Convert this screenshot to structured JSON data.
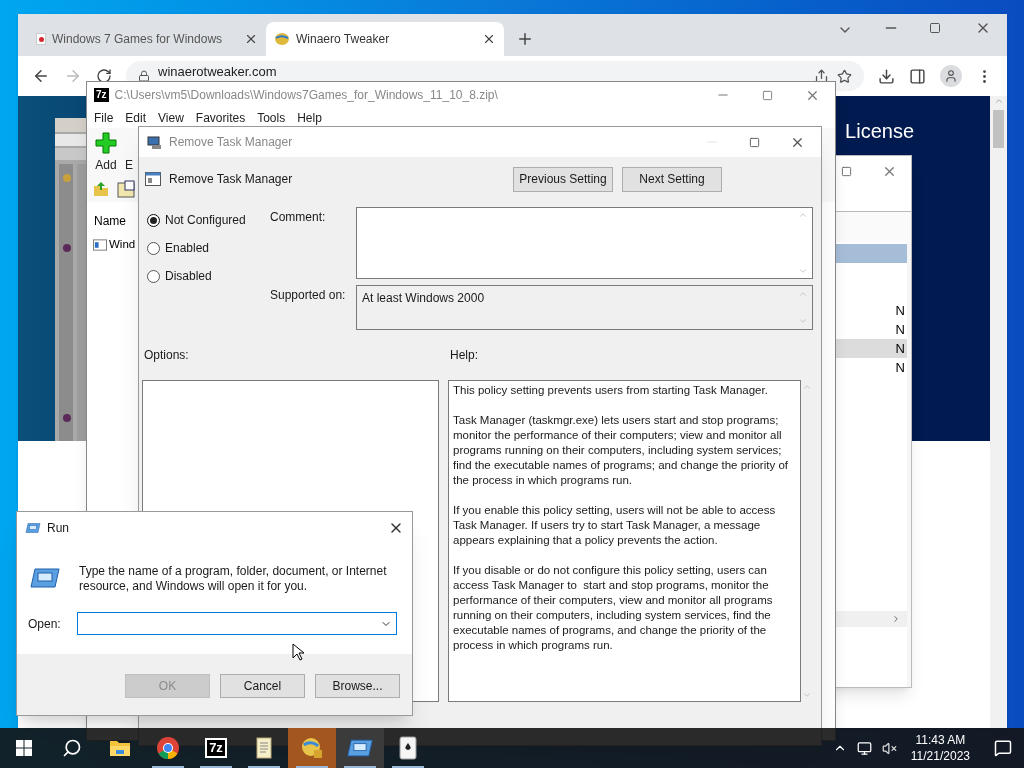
{
  "browser": {
    "tabs": [
      {
        "title": "Windows 7 Games for Windows",
        "selected": false
      },
      {
        "title": "Winaero Tweaker",
        "selected": true
      }
    ],
    "url": "winaerotweaker.com",
    "page_nav": [
      "License"
    ]
  },
  "back_window": {
    "rows": [
      {
        "selected": true,
        "hovered": false
      },
      {
        "cell": "N",
        "selected": false,
        "hovered": false
      },
      {
        "cell": "N",
        "selected": false,
        "hovered": false
      },
      {
        "cell": "N",
        "selected": false,
        "hovered": true
      },
      {
        "cell": "N",
        "selected": false,
        "hovered": false
      }
    ]
  },
  "archiver": {
    "icon_label": "7z",
    "title": "C:\\Users\\vm5\\Downloads\\Windows7Games_for_Windows_11_10_8.zip\\",
    "menu": [
      "File",
      "Edit",
      "View",
      "Favorites",
      "Tools",
      "Help"
    ],
    "toolbar": [
      "Add",
      "E"
    ],
    "columns": [
      "Name"
    ],
    "rows": [
      "Wind"
    ]
  },
  "policy": {
    "title": "Remove Task Manager",
    "heading": "Remove Task Manager",
    "nav_buttons": [
      "Previous Setting",
      "Next Setting"
    ],
    "states": [
      {
        "label": "Not Configured",
        "selected": true
      },
      {
        "label": "Enabled",
        "selected": false
      },
      {
        "label": "Disabled",
        "selected": false
      }
    ],
    "comment_label": "Comment:",
    "supported_label": "Supported on:",
    "supported_value": "At least Windows 2000",
    "options_label": "Options:",
    "help_label": "Help:",
    "help": [
      "This policy setting prevents users from starting Task Manager.",
      "Task Manager (taskmgr.exe) lets users start and stop programs; monitor the performance of their computers; view and monitor all programs running on their computers, including system services; find the executable names of programs; and change the priority of the process in which programs run.",
      "If you enable this policy setting, users will not be able to access Task Manager. If users try to start Task Manager, a message appears explaining that a policy prevents the action.",
      "If you disable or do not configure this policy setting, users can access Task Manager to  start and stop programs, monitor the performance of their computers, view and monitor all programs running on their computers, including system services, find the executable names of programs, and change the priority of the process in which programs run."
    ]
  },
  "run": {
    "title": "Run",
    "description": "Type the name of a program, folder, document, or Internet resource, and Windows will open it for you.",
    "open_label": "Open:",
    "buttons": [
      {
        "label": "OK",
        "disabled": true
      },
      {
        "label": "Cancel",
        "disabled": false
      },
      {
        "label": "Browse...",
        "disabled": false
      }
    ]
  },
  "taskbar": {
    "apps": [
      {
        "kind": "folder",
        "flashing": false,
        "active": false,
        "running": false
      },
      {
        "kind": "chrome",
        "flashing": false,
        "active": false,
        "running": true
      },
      {
        "kind": "archive",
        "label": "7z",
        "flashing": false,
        "active": false,
        "running": true
      },
      {
        "kind": "scroll",
        "flashing": false,
        "active": false,
        "running": true
      },
      {
        "kind": "globe",
        "flashing": true,
        "active": false,
        "running": true
      },
      {
        "kind": "run",
        "flashing": false,
        "active": true,
        "running": true
      },
      {
        "kind": "cards",
        "flashing": false,
        "active": false,
        "running": true
      }
    ],
    "time": "11:43 AM",
    "date": "11/21/2023"
  }
}
